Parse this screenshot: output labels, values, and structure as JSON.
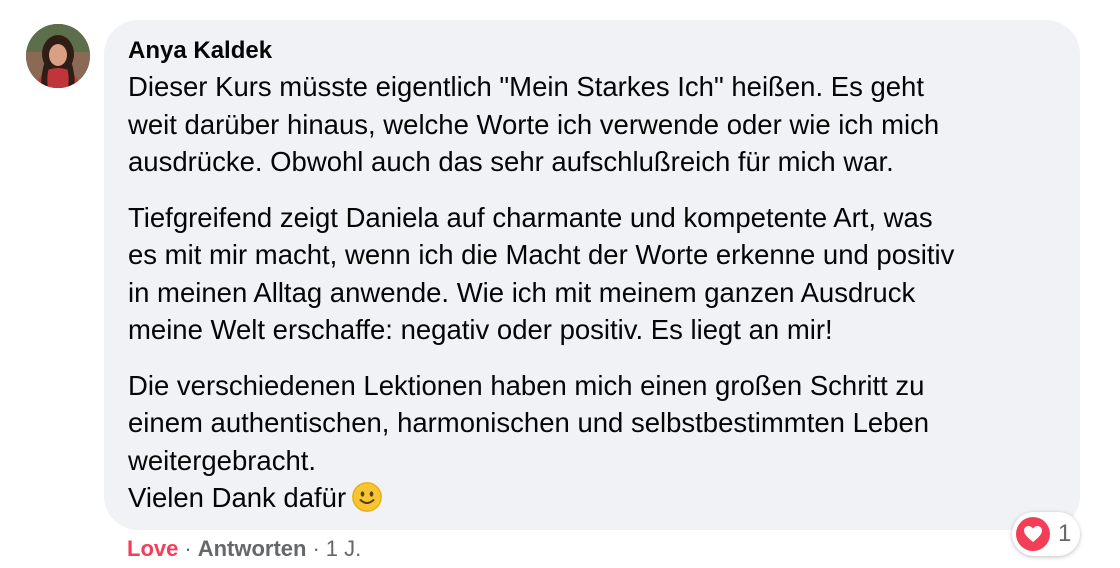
{
  "comment": {
    "author": "Anya Kaldek",
    "paragraphs": [
      "Dieser Kurs müsste eigentlich \"Mein Starkes Ich\" heißen. Es geht\nweit darüber hinaus, welche Worte ich verwende oder wie ich mich\nausdrücke. Obwohl auch das sehr aufschlußreich für mich war.",
      "Tiefgreifend zeigt Daniela auf charmante und kompetente Art, was\nes mit mir macht, wenn ich die Macht der Worte erkenne und positiv\nin meinen Alltag anwende. Wie ich mit meinem ganzen Ausdruck\nmeine Welt erschaffe: negativ oder positiv. Es liegt an mir!",
      "Die verschiedenen Lektionen haben mich einen großen Schritt zu\neinem authentischen, harmonischen und selbstbestimmten Leben\nweitergebracht.\nVielen Dank dafür"
    ],
    "emoji": "slightly-smiling-face-icon"
  },
  "reactions": {
    "type": "heart-icon",
    "count": "1",
    "color": "#f33e58"
  },
  "actions": {
    "love_label": "Love",
    "reply_label": "Antworten",
    "separator": "·",
    "timestamp": "1 J."
  },
  "colors": {
    "bubble": "#f0f2f5",
    "secondary_text": "#65676b",
    "love": "#f33e58"
  }
}
